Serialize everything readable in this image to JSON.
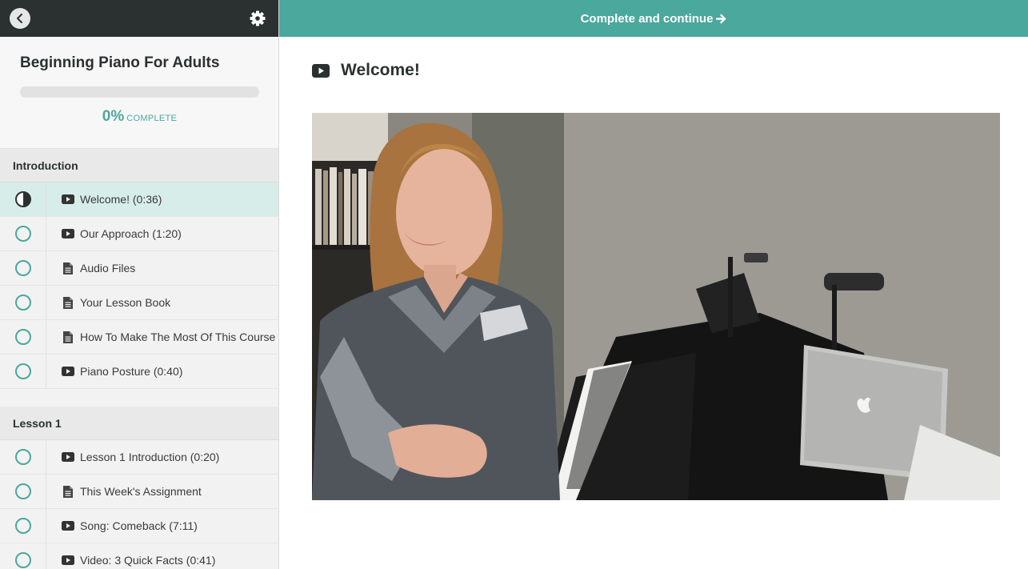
{
  "sidebar": {
    "course_title": "Beginning Piano For Adults",
    "progress": {
      "percent_text": "0%",
      "label": "COMPLETE",
      "fraction": 0.0
    },
    "sections": [
      {
        "title": "Introduction",
        "lectures": [
          {
            "title": "Welcome! (0:36)",
            "type": "video",
            "status": "in-progress"
          },
          {
            "title": "Our Approach (1:20)",
            "type": "video",
            "status": "incomplete"
          },
          {
            "title": "Audio Files",
            "type": "document",
            "status": "incomplete"
          },
          {
            "title": "Your Lesson Book",
            "type": "document",
            "status": "incomplete"
          },
          {
            "title": "How To Make The Most Of This Course",
            "type": "document",
            "status": "incomplete"
          },
          {
            "title": "Piano Posture (0:40)",
            "type": "video",
            "status": "incomplete"
          }
        ]
      },
      {
        "title": "Lesson 1",
        "lectures": [
          {
            "title": "Lesson 1 Introduction (0:20)",
            "type": "video",
            "status": "incomplete"
          },
          {
            "title": "This Week's Assignment",
            "type": "document",
            "status": "incomplete"
          },
          {
            "title": "Song: Comeback (7:11)",
            "type": "video",
            "status": "incomplete"
          },
          {
            "title": "Video: 3 Quick Facts (0:41)",
            "type": "video",
            "status": "incomplete"
          }
        ]
      }
    ]
  },
  "topbar": {
    "continue_label": "Complete and continue"
  },
  "main": {
    "lecture_title": "Welcome!"
  },
  "colors": {
    "accent": "#4aa89c",
    "dark": "#2b3131",
    "active_row": "#d7ede9"
  },
  "icons": {
    "back": "chevron-left-icon",
    "settings": "gear-icon",
    "continue": "arrow-right-icon",
    "video": "youtube-play-icon",
    "document": "file-text-icon"
  }
}
